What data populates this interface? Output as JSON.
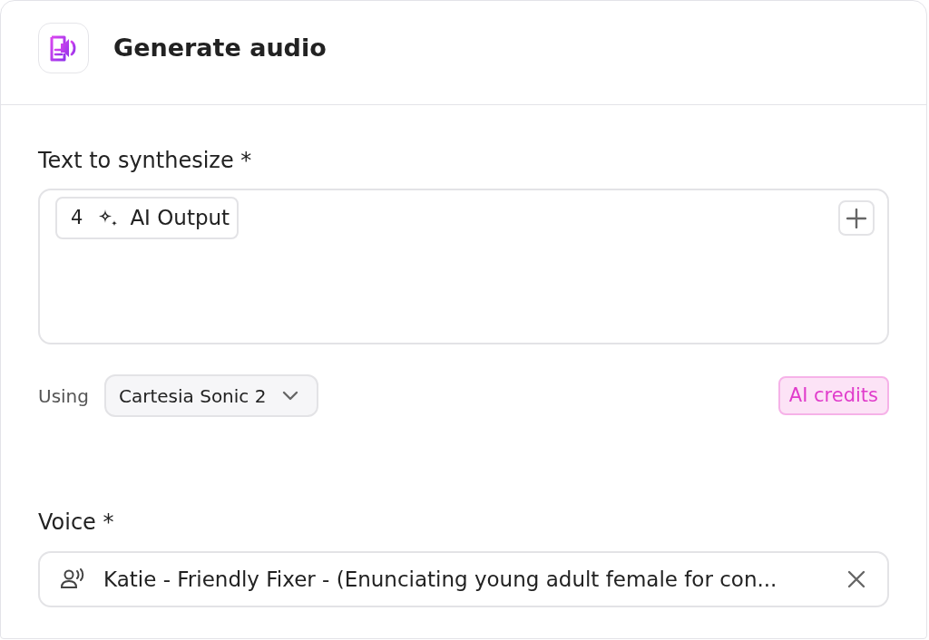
{
  "header": {
    "title": "Generate audio"
  },
  "text_field": {
    "label": "Text to synthesize *",
    "tokens": [
      {
        "step": "4",
        "label": "AI Output"
      }
    ]
  },
  "model": {
    "prefix": "Using",
    "value": "Cartesia Sonic 2",
    "badge": "AI credits"
  },
  "voice": {
    "label": "Voice *",
    "value": "Katie - Friendly Fixer - (Enunciating young adult female for con..."
  }
}
